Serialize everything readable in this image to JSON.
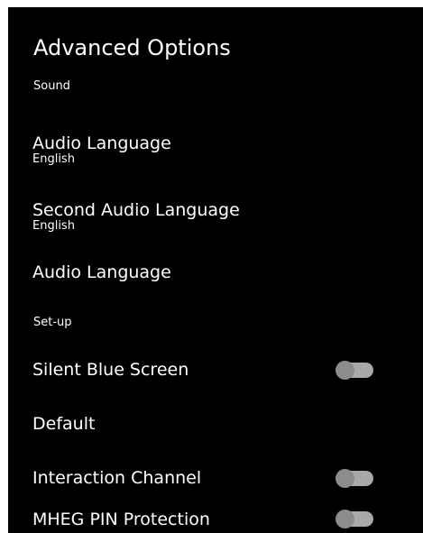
{
  "page": {
    "title": "Advanced Options"
  },
  "sections": {
    "sound": "Sound",
    "setup": "Set-up"
  },
  "items": {
    "audio_language": {
      "label": "Audio Language",
      "value": "English"
    },
    "second_audio_language": {
      "label": "Second Audio Language",
      "value": "English"
    },
    "audio_language_2": {
      "label": "Audio Language"
    },
    "silent_blue_screen": {
      "label": "Silent Blue Screen",
      "enabled": false
    },
    "default": {
      "label": "Default"
    },
    "interaction_channel": {
      "label": "Interaction Channel",
      "enabled": false
    },
    "mheg_pin_protection": {
      "label": "MHEG PIN Protection",
      "enabled": false
    }
  },
  "colors": {
    "background": "#000000",
    "text": "#ffffff",
    "toggle_track": "#a9a9a9",
    "toggle_knob": "#8c8c8c"
  }
}
